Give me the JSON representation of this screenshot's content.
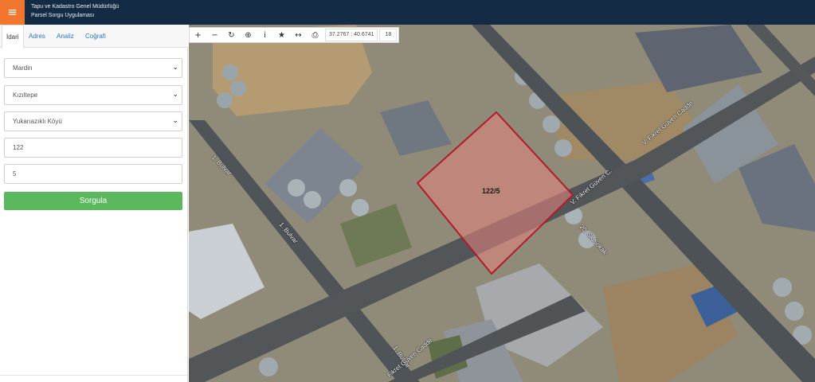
{
  "header": {
    "menu_icon": "hamburger-icon",
    "title_line1": "Tapu ve Kadastro Genel Müdürlüğü",
    "title_line2": "Parsel Sorgu Uygulaması",
    "bg_color": "#132b44",
    "accent_color": "#f0772d"
  },
  "sidebar": {
    "tabs": [
      {
        "label": "İdari",
        "active": true
      },
      {
        "label": "Adres"
      },
      {
        "label": "Analiz"
      },
      {
        "label": "Coğrafi"
      }
    ],
    "form": {
      "province": "Mardin",
      "district": "Kızıltepe",
      "neighborhood": "Yukarıazıklı Köyü",
      "block": "122",
      "parcel": "5"
    },
    "query_button": "Sorgula",
    "button_color": "#5cb85c"
  },
  "map": {
    "toolbar": {
      "tools": [
        "zoom-in-icon",
        "zoom-out-icon",
        "refresh-icon",
        "locate-icon",
        "info-icon",
        "favorite-icon",
        "measure-icon",
        "print-icon"
      ],
      "coordinates": "37.2767 : 40.6741",
      "zoom_level": "18"
    },
    "parcel_label": "122/5",
    "road_labels": {
      "bulvar_top": "1. Bulvar",
      "bulvar_mid": "1. Bulvar",
      "bulvar_bottom": "1. Bulvar",
      "fikret_right": "V. Fikret Güven Cadde",
      "fikret_mid": "V. Fikret Güven C.",
      "fikret_bottom": "Fikret Güven Cadde",
      "sokak": "20. Sk.Sokak"
    },
    "parcel_color": "#b01c2b"
  }
}
